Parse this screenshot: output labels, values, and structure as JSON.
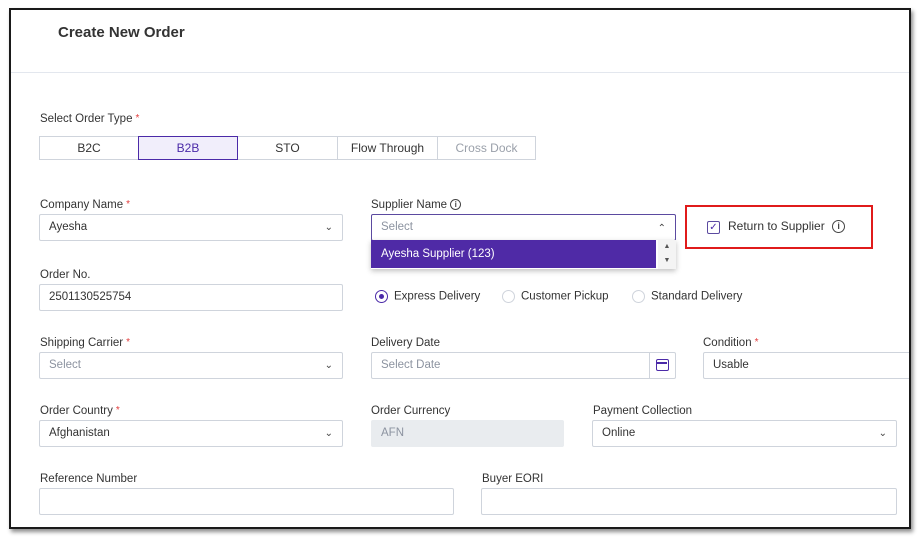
{
  "page": {
    "title": "Create New Order"
  },
  "order_type": {
    "label": "Select Order Type",
    "options": [
      "B2C",
      "B2B",
      "STO",
      "Flow Through",
      "Cross Dock"
    ],
    "selected": "B2B"
  },
  "company": {
    "label": "Company Name",
    "value": "Ayesha"
  },
  "supplier": {
    "label": "Supplier Name",
    "placeholder": "Select",
    "dropdown_option": "Ayesha Supplier (123)"
  },
  "return_to_supplier": {
    "label": "Return to Supplier",
    "checked": true
  },
  "order_no": {
    "label": "Order No.",
    "value": "2501130525754"
  },
  "delivery_method": {
    "options": [
      "Express Delivery",
      "Customer Pickup",
      "Standard Delivery"
    ],
    "selected": "Express Delivery"
  },
  "shipping_carrier": {
    "label": "Shipping Carrier",
    "placeholder": "Select"
  },
  "delivery_date": {
    "label": "Delivery Date",
    "placeholder": "Select Date"
  },
  "condition": {
    "label": "Condition",
    "value": "Usable"
  },
  "order_country": {
    "label": "Order Country",
    "value": "Afghanistan"
  },
  "order_currency": {
    "label": "Order Currency",
    "value": "AFN"
  },
  "payment_collection": {
    "label": "Payment Collection",
    "value": "Online"
  },
  "reference_number": {
    "label": "Reference Number",
    "value": ""
  },
  "buyer_eori": {
    "label": "Buyer EORI",
    "value": ""
  },
  "required_marker": "*",
  "colors": {
    "accent": "#4b2aa8",
    "dropdown_highlight": "#4f2aa6",
    "highlight_box": "#e01b1b",
    "required": "#e23b3b"
  }
}
